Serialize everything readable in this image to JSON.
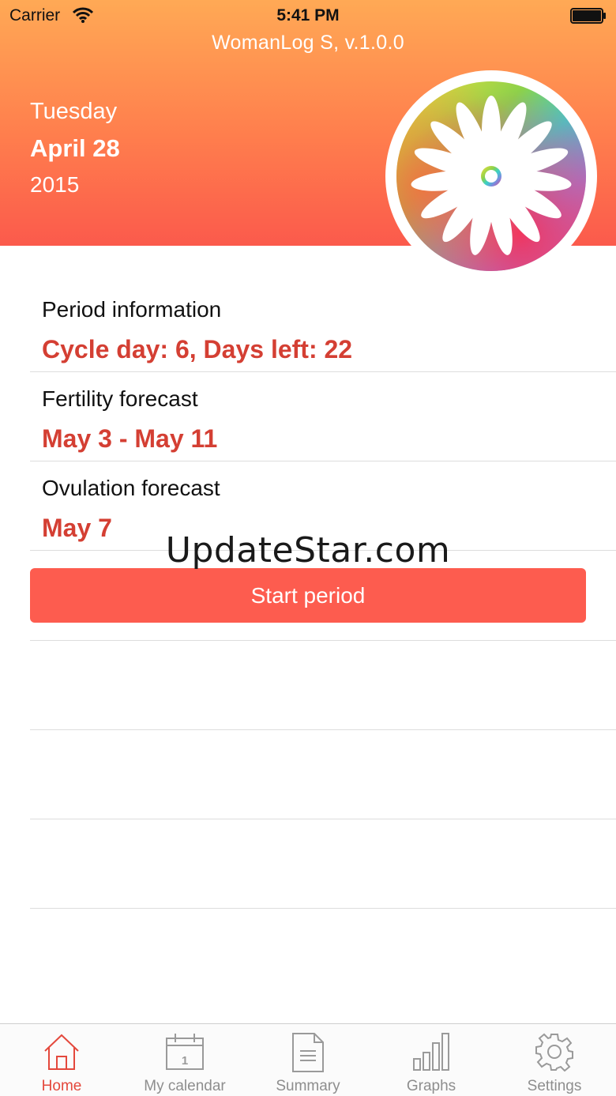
{
  "status_bar": {
    "carrier": "Carrier",
    "time": "5:41 PM"
  },
  "app_title": "WomanLog S, v.1.0.0",
  "today": {
    "weekday": "Tuesday",
    "date": "April 28",
    "year": "2015"
  },
  "rows": [
    {
      "title": "Period information",
      "value": "Cycle day: 6,  Days left: 22"
    },
    {
      "title": "Fertility forecast",
      "value": "May 3 - May 11"
    },
    {
      "title": "Ovulation forecast",
      "value": "May 7"
    }
  ],
  "watermark": "UpdateStar.com",
  "start_button": "Start period",
  "tabs": [
    {
      "label": "Home",
      "icon": "home-icon",
      "active": true
    },
    {
      "label": "My calendar",
      "icon": "calendar-icon",
      "calendar_day": "1"
    },
    {
      "label": "Summary",
      "icon": "document-icon"
    },
    {
      "label": "Graphs",
      "icon": "bar-graph-icon"
    },
    {
      "label": "Settings",
      "icon": "gear-icon"
    }
  ],
  "colors": {
    "accent": "#d43f33",
    "button": "#fd5c4f",
    "header_top": "#ffa955",
    "header_bottom": "#fb5a4c",
    "tab_active": "#e4483c",
    "tab_inactive": "#8e8e8e"
  }
}
